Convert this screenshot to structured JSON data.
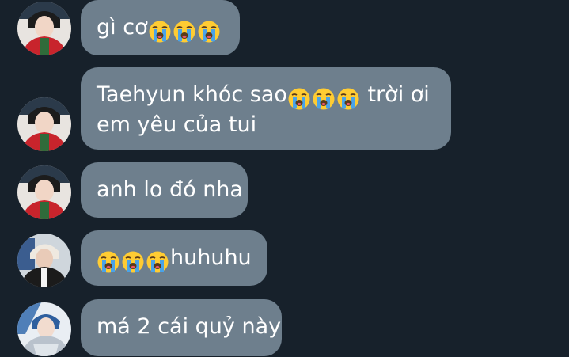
{
  "messages": [
    {
      "avatar": "person-red-jacket-avatar",
      "lines": [
        {
          "pre": "gì cơ",
          "emojis": [
            "loudly-crying-face-icon",
            "loudly-crying-face-icon",
            "loudly-crying-face-icon"
          ],
          "post": ""
        }
      ]
    },
    {
      "avatar": "person-red-jacket-avatar",
      "lines": [
        {
          "pre": "Taehyun khóc sao",
          "emojis": [
            "loudly-crying-face-icon",
            "loudly-crying-face-icon",
            "loudly-crying-face-icon"
          ],
          "post": " trời ơi"
        },
        {
          "pre": "em yêu của tui",
          "emojis": [],
          "post": ""
        }
      ]
    },
    {
      "avatar": "person-red-jacket-avatar",
      "lines": [
        {
          "pre": "anh lo đó nha",
          "emojis": [],
          "post": ""
        }
      ]
    },
    {
      "avatar": "person-black-jacket-avatar",
      "lines": [
        {
          "pre": "",
          "emojis": [
            "loudly-crying-face-icon",
            "loudly-crying-face-icon",
            "loudly-crying-face-icon"
          ],
          "post": "huhuhu"
        }
      ]
    },
    {
      "avatar": "person-blue-hair-avatar",
      "lines": [
        {
          "pre": "má 2 cái quỷ này",
          "emojis": [],
          "post": ""
        }
      ]
    }
  ]
}
